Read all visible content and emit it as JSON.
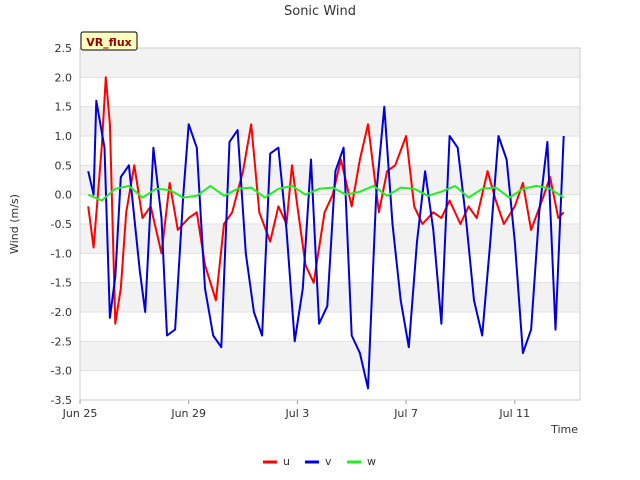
{
  "chart_data": {
    "type": "line",
    "title": "Sonic Wind",
    "badge": "VR_flux",
    "xlabel": "Time",
    "ylabel": "Wind (m/s)",
    "ylim": [
      -3.5,
      2.5
    ],
    "yticks": [
      2.5,
      2.0,
      1.5,
      1.0,
      0.5,
      0.0,
      -0.5,
      -1.0,
      -1.5,
      -2.0,
      -2.5,
      -3.0,
      -3.5
    ],
    "ytick_labels": [
      "2.5",
      "2.0",
      "1.5",
      "1.0",
      "0.5",
      "0.0",
      "-0.5",
      "-1.0",
      "-1.5",
      "-2.0",
      "-2.5",
      "-3.0",
      "-3.5"
    ],
    "xlim": [
      0,
      18.4
    ],
    "x_unit": "days since Jun 25",
    "xticks": [
      0,
      4,
      8,
      12,
      16
    ],
    "xtick_labels": [
      "Jun 25",
      "Jun 29",
      "Jul 3",
      "Jul 7",
      "Jul 11"
    ],
    "grid": "horizontal bands",
    "legend_position": "bottom",
    "colors": {
      "u": "#ff0000",
      "v": "#0000dd",
      "w": "#22ee22",
      "band": "#f2f2f2",
      "badge_bg": "#ffffc0",
      "badge_text": "#990000"
    },
    "series": [
      {
        "name": "u",
        "x": [
          0.3,
          0.5,
          0.8,
          0.95,
          1.1,
          1.3,
          1.5,
          1.7,
          2.0,
          2.3,
          2.6,
          3.0,
          3.3,
          3.6,
          4.0,
          4.3,
          4.6,
          5.0,
          5.3,
          5.6,
          6.0,
          6.3,
          6.6,
          7.0,
          7.3,
          7.6,
          7.8,
          8.0,
          8.3,
          8.6,
          9.0,
          9.3,
          9.6,
          10.0,
          10.3,
          10.6,
          11.0,
          11.3,
          11.6,
          12.0,
          12.3,
          12.6,
          13.0,
          13.3,
          13.6,
          14.0,
          14.3,
          14.6,
          15.0,
          15.3,
          15.6,
          16.0,
          16.3,
          16.6,
          17.0,
          17.3,
          17.6,
          17.8
        ],
        "values": [
          -0.2,
          -0.9,
          0.8,
          2.0,
          1.2,
          -2.2,
          -1.6,
          -0.3,
          0.5,
          -0.4,
          -0.2,
          -1.0,
          0.2,
          -0.6,
          -0.4,
          -0.3,
          -1.2,
          -1.8,
          -0.5,
          -0.3,
          0.4,
          1.2,
          -0.3,
          -0.8,
          -0.2,
          -0.5,
          0.5,
          -0.2,
          -1.2,
          -1.5,
          -0.3,
          0.0,
          0.6,
          -0.2,
          0.6,
          1.2,
          -0.3,
          0.4,
          0.5,
          1.0,
          -0.2,
          -0.5,
          -0.3,
          -0.4,
          -0.1,
          -0.5,
          -0.2,
          -0.4,
          0.4,
          -0.1,
          -0.5,
          -0.2,
          0.2,
          -0.6,
          -0.1,
          0.3,
          -0.4,
          -0.3
        ]
      },
      {
        "name": "v",
        "x": [
          0.3,
          0.5,
          0.6,
          0.9,
          1.1,
          1.3,
          1.5,
          1.8,
          2.2,
          2.4,
          2.7,
          3.0,
          3.2,
          3.5,
          3.8,
          4.0,
          4.3,
          4.6,
          4.9,
          5.2,
          5.5,
          5.8,
          6.1,
          6.4,
          6.7,
          7.0,
          7.3,
          7.6,
          7.9,
          8.2,
          8.5,
          8.8,
          9.1,
          9.4,
          9.7,
          10.0,
          10.3,
          10.6,
          10.9,
          11.2,
          11.5,
          11.8,
          12.1,
          12.4,
          12.7,
          13.0,
          13.3,
          13.6,
          13.9,
          14.2,
          14.5,
          14.8,
          15.1,
          15.4,
          15.7,
          16.0,
          16.3,
          16.6,
          16.9,
          17.2,
          17.5,
          17.8
        ],
        "values": [
          0.4,
          0.0,
          1.6,
          0.8,
          -2.1,
          -1.4,
          0.3,
          0.5,
          -1.3,
          -2.0,
          0.8,
          -0.4,
          -2.4,
          -2.3,
          0.0,
          1.2,
          0.8,
          -1.6,
          -2.4,
          -2.6,
          0.9,
          1.1,
          -1.0,
          -2.0,
          -2.4,
          0.7,
          0.8,
          -0.6,
          -2.5,
          -1.6,
          0.6,
          -2.2,
          -1.9,
          0.4,
          0.8,
          -2.4,
          -2.7,
          -3.3,
          0.0,
          1.5,
          -0.5,
          -1.8,
          -2.6,
          -0.8,
          0.4,
          -0.6,
          -2.2,
          1.0,
          0.8,
          -0.4,
          -1.8,
          -2.4,
          -0.8,
          1.0,
          0.6,
          -0.8,
          -2.7,
          -2.3,
          -0.3,
          0.9,
          -2.3,
          1.0
        ]
      },
      {
        "name": "w",
        "x": [
          0.3,
          0.8,
          1.3,
          1.8,
          2.3,
          2.8,
          3.3,
          3.8,
          4.3,
          4.8,
          5.3,
          5.8,
          6.3,
          6.8,
          7.3,
          7.8,
          8.3,
          8.8,
          9.3,
          9.8,
          10.3,
          10.8,
          11.3,
          11.8,
          12.3,
          12.8,
          13.3,
          13.8,
          14.3,
          14.8,
          15.3,
          15.8,
          16.3,
          16.8,
          17.3,
          17.8
        ],
        "values": [
          0.0,
          -0.1,
          0.1,
          0.15,
          -0.05,
          0.1,
          0.08,
          -0.05,
          -0.02,
          0.15,
          -0.02,
          0.1,
          0.12,
          -0.05,
          0.1,
          0.15,
          0.0,
          0.1,
          0.12,
          0.0,
          0.05,
          0.15,
          -0.02,
          0.12,
          0.1,
          -0.02,
          0.05,
          0.15,
          -0.05,
          0.1,
          0.12,
          -0.05,
          0.1,
          0.15,
          0.1,
          -0.05
        ]
      }
    ]
  }
}
